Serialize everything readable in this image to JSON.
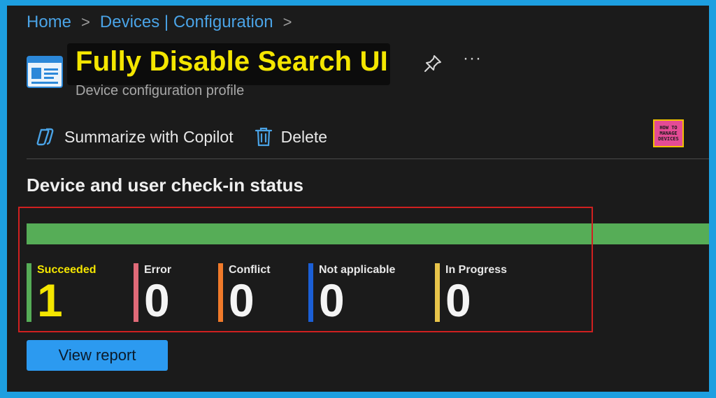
{
  "breadcrumb": {
    "items": [
      "Home",
      "Devices | Configuration"
    ],
    "separator": ">"
  },
  "header": {
    "title": "Fully Disable Search UI",
    "subtitle": "Device configuration profile",
    "more_label": "···"
  },
  "toolbar": {
    "copilot_label": "Summarize with Copilot",
    "delete_label": "Delete"
  },
  "logo": {
    "line1": "HOW TO",
    "line2": "MANAGE",
    "line3": "DEVICES"
  },
  "status": {
    "title": "Device and user check-in status",
    "succeeded_fraction": 1.0,
    "stats": [
      {
        "label": "Succeeded",
        "value": "1",
        "color": "#56ad57"
      },
      {
        "label": "Error",
        "value": "0",
        "color": "#e06a78"
      },
      {
        "label": "Conflict",
        "value": "0",
        "color": "#f07a2a"
      },
      {
        "label": "Not applicable",
        "value": "0",
        "color": "#1b5fd6"
      },
      {
        "label": "In Progress",
        "value": "0",
        "color": "#e8c44a"
      }
    ]
  },
  "actions": {
    "view_report_label": "View report"
  },
  "colors": {
    "accent": "#2c9af0",
    "title_highlight": "#f4e600",
    "success": "#56ad57",
    "annotation_box": "#d02020"
  }
}
